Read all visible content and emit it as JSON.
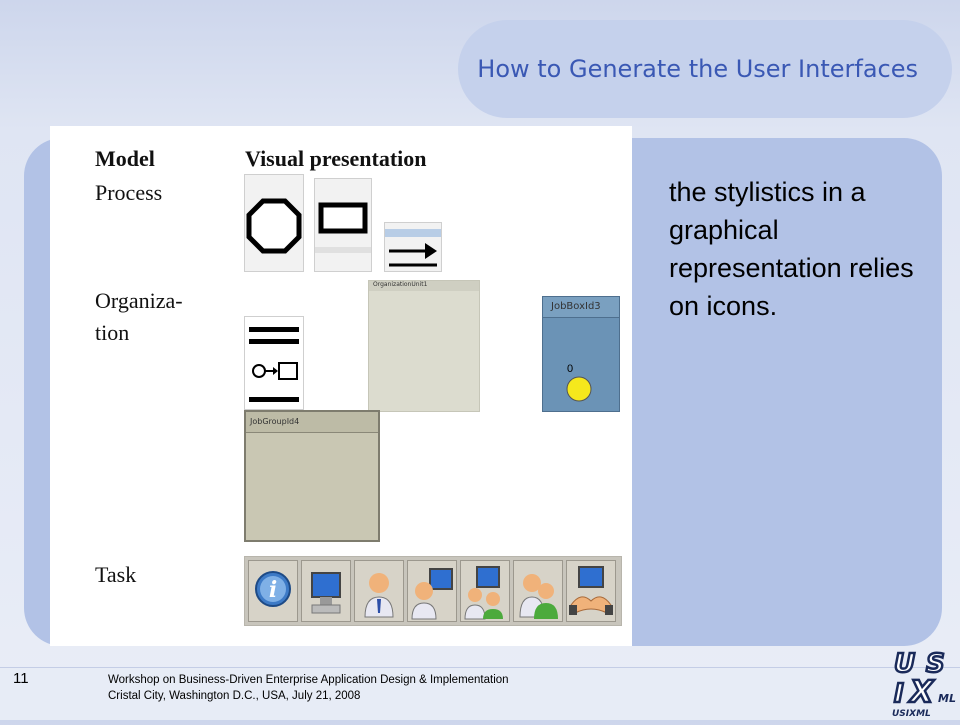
{
  "slide": {
    "title": "How to Generate the User Interfaces",
    "body": "the stylistics in a graphical representation relies on icons.",
    "page_number": "11"
  },
  "figure": {
    "header_model": "Model",
    "header_visual": "Visual presentation",
    "row_process": "Process",
    "row_org_1": "Organiza-",
    "row_org_2": "tion",
    "row_task": "Task",
    "org_unit_label": "OrganizationUnit1",
    "job_box_label": "JobBoxId3",
    "job_box_marker": "0",
    "job_group_label": "JobGroupId4"
  },
  "footer": {
    "line1": "Workshop on Business-Driven Enterprise Application Design & Implementation",
    "line2": "Cristal City, Washington D.C., USA, July 21, 2008"
  },
  "logo": {
    "text": "USIXML"
  },
  "icons": {
    "task": [
      "info-icon",
      "computer-icon",
      "user-icon",
      "user-computer-icon",
      "group-computer-icon",
      "group-icon",
      "handshake-computer-icon"
    ]
  },
  "colors": {
    "title": "#3a58b4",
    "panel": "#b2c2e6",
    "job_box": "#6b93b6",
    "job_marker": "#f5e81c"
  }
}
